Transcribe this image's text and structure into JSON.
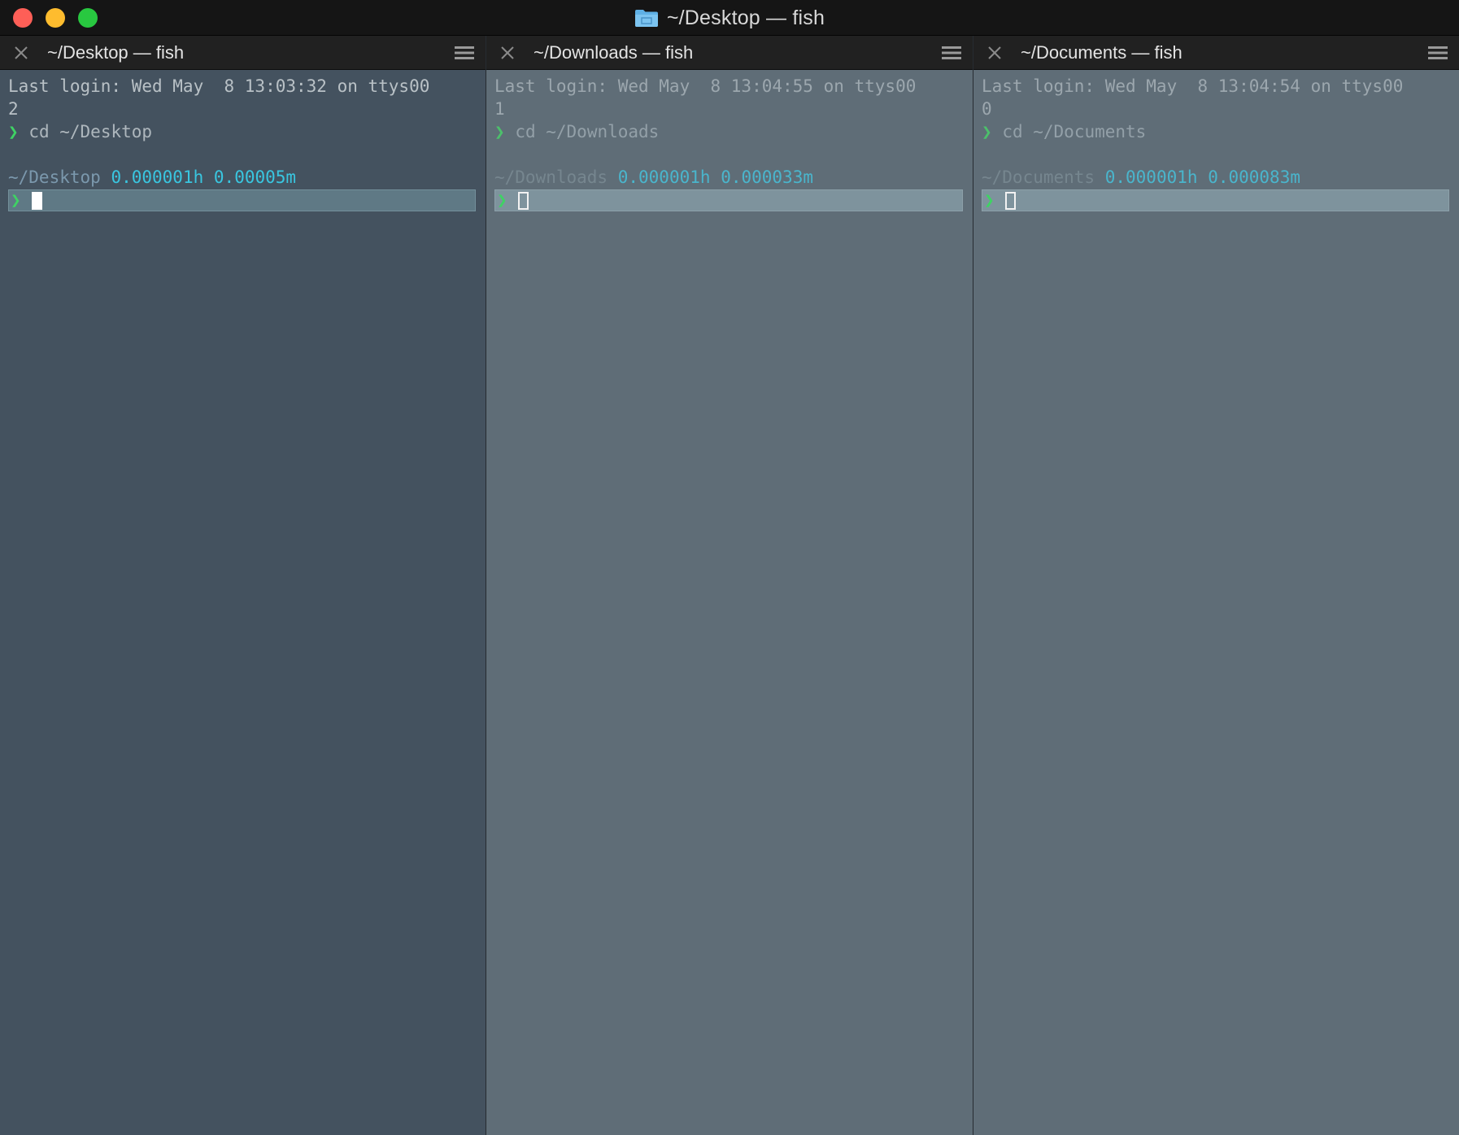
{
  "window": {
    "title": "~/Desktop — fish",
    "title_icon": "folder-icon",
    "controls": [
      "close",
      "minimize",
      "zoom"
    ]
  },
  "colors": {
    "active_bg": "#44525f",
    "inactive_bg": "#5f6d77",
    "prompt_arrow": "#3fd264",
    "timing": "#39c6e0"
  },
  "panes": [
    {
      "tab_title": "~/Desktop — fish",
      "active": true,
      "login_line": "Last login: Wed May  8 13:03:32 on ttys00",
      "login_wrap": "2",
      "prompt_symbol": "❯",
      "command": "cd ~/Desktop",
      "cwd": "~/Desktop",
      "timing_hours": "0.000001h",
      "timing_minutes": "0.00005m",
      "cursor_style": "block"
    },
    {
      "tab_title": "~/Downloads — fish",
      "active": false,
      "login_line": "Last login: Wed May  8 13:04:55 on ttys00",
      "login_wrap": "1",
      "prompt_symbol": "❯",
      "command": "cd ~/Downloads",
      "cwd": "~/Downloads",
      "timing_hours": "0.000001h",
      "timing_minutes": "0.000033m",
      "cursor_style": "hollow"
    },
    {
      "tab_title": "~/Documents — fish",
      "active": false,
      "login_line": "Last login: Wed May  8 13:04:54 on ttys00",
      "login_wrap": "0",
      "prompt_symbol": "❯",
      "command": "cd ~/Documents",
      "cwd": "~/Documents",
      "timing_hours": "0.000001h",
      "timing_minutes": "0.000083m",
      "cursor_style": "hollow"
    }
  ]
}
